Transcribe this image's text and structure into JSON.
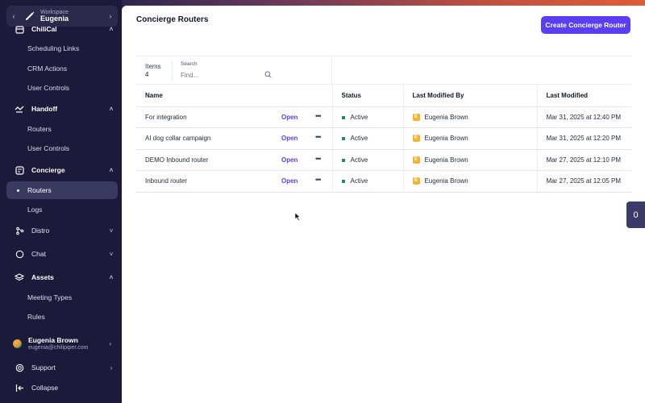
{
  "workspace": {
    "label": "Workspace",
    "name": "Eugenia"
  },
  "sidebar": {
    "sections": [
      {
        "label": "ChiliCal",
        "items": [
          "Scheduling Links",
          "CRM Actions",
          "User Controls"
        ]
      },
      {
        "label": "Handoff",
        "items": [
          "Routers",
          "User Controls"
        ]
      },
      {
        "label": "Concierge",
        "items": [
          "Routers",
          "Logs"
        ],
        "active_item": "Routers"
      },
      {
        "label": "Distro"
      },
      {
        "label": "Chat"
      },
      {
        "label": "Assets",
        "items": [
          "Meeting Types",
          "Rules"
        ]
      }
    ],
    "user": {
      "name": "Eugenia Brown",
      "email": "eugenia@chilipiper.com"
    },
    "support_label": "Support",
    "collapse_label": "Collapse"
  },
  "main": {
    "title": "Concierge Routers",
    "create_button": "Create Concierge Router",
    "items_label": "Items",
    "items_count": "4",
    "search_label": "Search",
    "search_placeholder": "Find...",
    "columns": [
      "Name",
      "Status",
      "Last Modified By",
      "Last Modified"
    ],
    "open_label": "Open",
    "rows": [
      {
        "name": "For integration",
        "status": "Active",
        "modified_by": "Eugenia Brown",
        "modified_by_initial": "E",
        "modified": "Mar 31, 2025 at 12:40 PM"
      },
      {
        "name": "AI dog collar campaign",
        "status": "Active",
        "modified_by": "Eugenia Brown",
        "modified_by_initial": "E",
        "modified": "Mar 31, 2025 at 12:20 PM"
      },
      {
        "name": "DEMO Inbound router",
        "status": "Active",
        "modified_by": "Eugenia Brown",
        "modified_by_initial": "E",
        "modified": "Mar 27, 2025 at 12:10 PM"
      },
      {
        "name": "Inbound router",
        "status": "Active",
        "modified_by": "Eugenia Brown",
        "modified_by_initial": "E",
        "modified": "Mar 27, 2025 at 12:05 PM"
      }
    ]
  },
  "side_tab": {
    "count": "0"
  },
  "colors": {
    "accent": "#5b3df5",
    "sidebar_bg": "#1b1a3a",
    "status_active": "#1f8f5c",
    "badge": "#f2b431"
  }
}
